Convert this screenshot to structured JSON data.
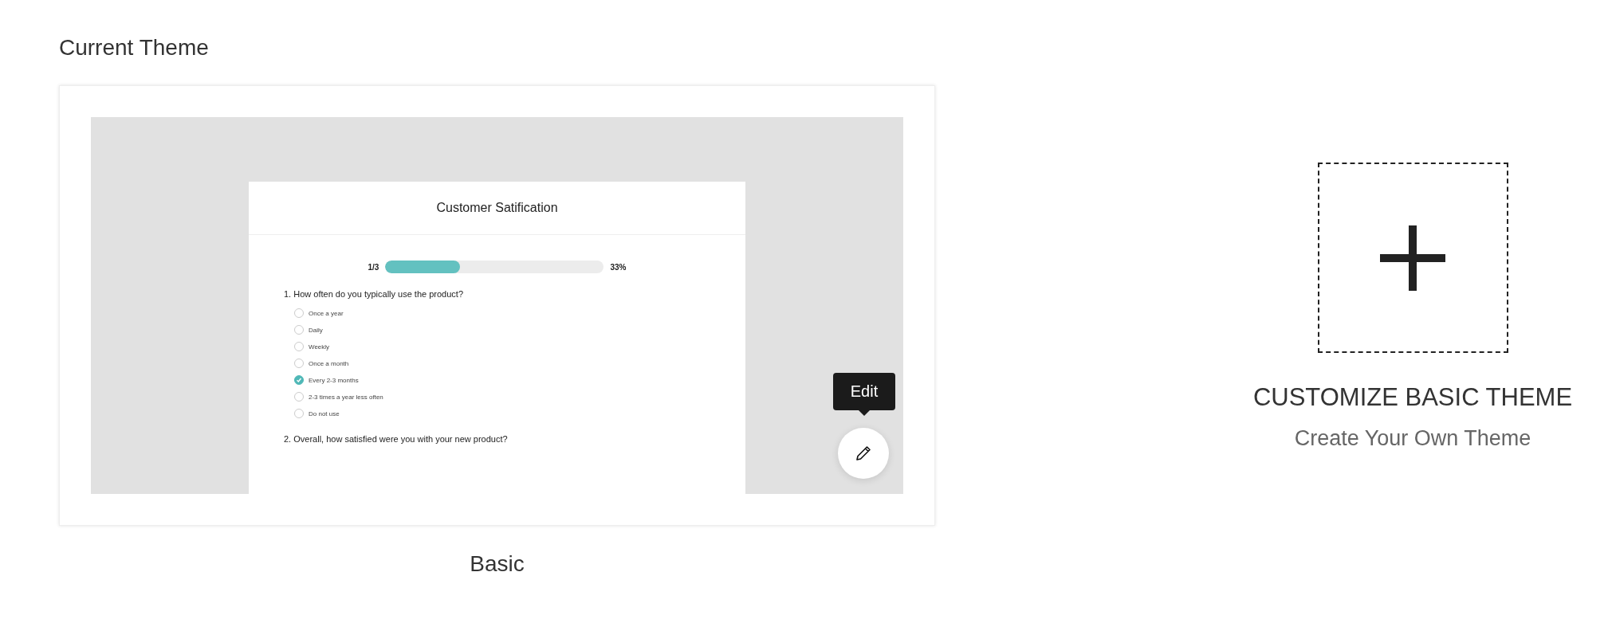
{
  "heading": "Current Theme",
  "current_theme": {
    "name": "Basic",
    "preview": {
      "title": "Customer Satification",
      "progress": {
        "label": "1/3",
        "level": 0.34,
        "reading": "33%"
      },
      "questions": [
        {
          "text": "1. How often do you typically use the product?",
          "options": [
            {
              "label": "Once a year",
              "selected": false
            },
            {
              "label": "Daily",
              "selected": false
            },
            {
              "label": "Weekly",
              "selected": false
            },
            {
              "label": "Once a month",
              "selected": false
            },
            {
              "label": "Every 2-3 months",
              "selected": true
            },
            {
              "label": "2-3 times a year less often",
              "selected": false
            },
            {
              "label": "Do not use",
              "selected": false
            }
          ]
        },
        {
          "text": "2. Overall, how satisfied were you with your new product?"
        }
      ]
    },
    "edit_tooltip": "Edit"
  },
  "customize": {
    "title": "CUSTOMIZE BASIC THEME",
    "subtitle": "Create Your Own Theme"
  }
}
